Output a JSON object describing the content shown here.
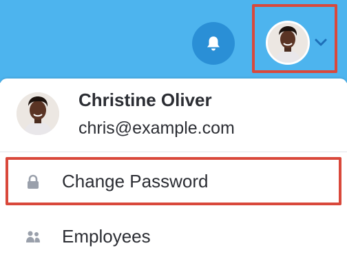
{
  "header": {
    "notifications_icon": "bell-icon",
    "avatar_icon": "user-avatar",
    "chevron_icon": "chevron-down-icon",
    "colors": {
      "bar": "#4db4ee",
      "bell_button": "#2a8fd6",
      "highlight": "#d9483b"
    }
  },
  "dropdown": {
    "user": {
      "name": "Christine Oliver",
      "email": "chris@example.com"
    },
    "items": [
      {
        "label": "Change Password",
        "icon": "lock-icon"
      },
      {
        "label": "Employees",
        "icon": "people-icon"
      }
    ]
  }
}
